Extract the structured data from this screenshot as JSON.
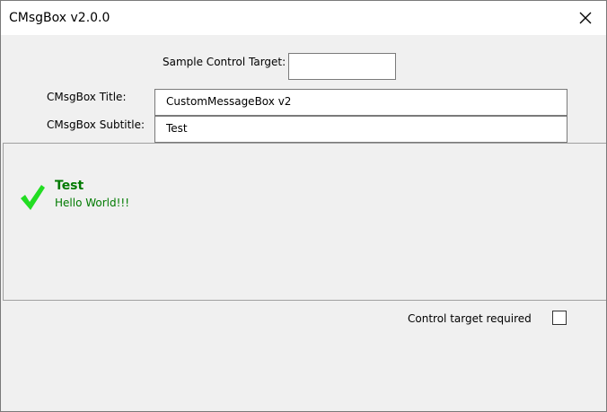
{
  "window": {
    "title": "CMsgBox v2.0.0",
    "close_icon": "close-icon"
  },
  "form": {
    "sample_target_label": "Sample Control Target:",
    "sample_target_value": "",
    "title_label": "CMsgBox Title:",
    "title_value": "CustomMessageBox v2",
    "subtitle_label": "CMsgBox Subtitle:",
    "subtitle_value": "Test"
  },
  "message": {
    "icon": "checkmark-icon",
    "icon_color": "#22dd22",
    "title": "Test",
    "body": "Hello World!!!",
    "text_color": "#007a00"
  },
  "options": {
    "control_target_required_label": "Control target required",
    "control_target_required_checked": false
  }
}
